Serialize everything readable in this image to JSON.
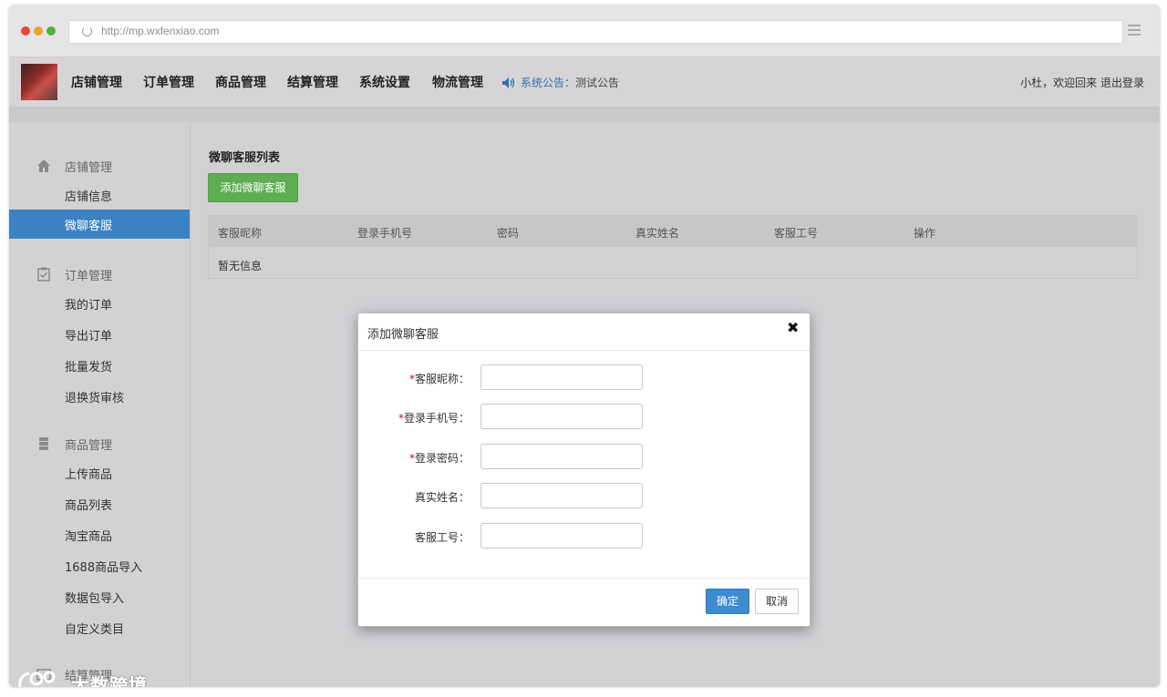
{
  "browser": {
    "url": "http://mp.wxfenxiao.com"
  },
  "topnav": {
    "items": [
      "店铺管理",
      "订单管理",
      "商品管理",
      "结算管理",
      "系统设置",
      "物流管理"
    ],
    "announcement_label": "系统公告",
    "announcement_colon": "：",
    "announcement_value": "测试公告",
    "welcome": "小杜，欢迎回来",
    "logout": "退出登录"
  },
  "sidebar": {
    "groups": [
      {
        "label": "店铺管理",
        "icon": "home-icon",
        "items": [
          {
            "label": "店铺信息",
            "active": false
          },
          {
            "label": "微聊客服",
            "active": true
          }
        ]
      },
      {
        "label": "订单管理",
        "icon": "clipboard-check-icon",
        "items": [
          {
            "label": "我的订单"
          },
          {
            "label": "导出订单"
          },
          {
            "label": "批量发货"
          },
          {
            "label": "退换货审核"
          }
        ]
      },
      {
        "label": "商品管理",
        "icon": "database-icon",
        "items": [
          {
            "label": "上传商品"
          },
          {
            "label": "商品列表"
          },
          {
            "label": "淘宝商品"
          },
          {
            "label": "1688商品导入"
          },
          {
            "label": "数据包导入"
          },
          {
            "label": "自定义类目"
          }
        ]
      },
      {
        "label": "结算管理",
        "icon": "wallet-icon",
        "items": []
      }
    ]
  },
  "main": {
    "title": "微聊客服列表",
    "add_button": "添加微聊客服",
    "table": {
      "columns": [
        "客服昵称",
        "登录手机号",
        "密码",
        "真实姓名",
        "客服工号",
        "操作"
      ],
      "empty_text": "暂无信息"
    }
  },
  "modal": {
    "title": "添加微聊客服",
    "close": "✖",
    "fields": [
      {
        "label": "客服昵称：",
        "required": true,
        "value": ""
      },
      {
        "label": "登录手机号：",
        "required": true,
        "value": ""
      },
      {
        "label": "登录密码：",
        "required": true,
        "value": ""
      },
      {
        "label": "真实姓名：",
        "required": false,
        "value": ""
      },
      {
        "label": "客服工号：",
        "required": false,
        "value": ""
      }
    ],
    "required_mark": "*",
    "ok": "确定",
    "cancel": "取消"
  },
  "watermark": {
    "text": "大数跨境"
  },
  "colors": {
    "accent_blue": "#3b82c4",
    "add_green": "#5cae50",
    "required_red": "#d0021b"
  }
}
